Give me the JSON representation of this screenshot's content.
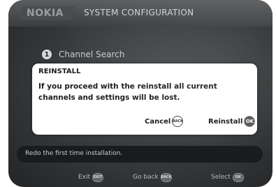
{
  "header": {
    "brand": "NOKIA",
    "title": "SYSTEM CONFIGURATION"
  },
  "menu": {
    "item_number": "1",
    "item_label": "Channel Search"
  },
  "dialog": {
    "title": "REINSTALL",
    "message": "If you proceed with the reinstall all current channels and settings will be lost.",
    "cancel_label": "Cancel",
    "cancel_key": "BACK",
    "confirm_label": "Reinstall",
    "confirm_key": "OK"
  },
  "help": {
    "text": "Redo the first time installation."
  },
  "footer": {
    "exit_label": "Exit",
    "exit_key": "EXIT",
    "back_label": "Go back",
    "back_key": "BACK",
    "select_label": "Select",
    "select_key": "OK"
  }
}
